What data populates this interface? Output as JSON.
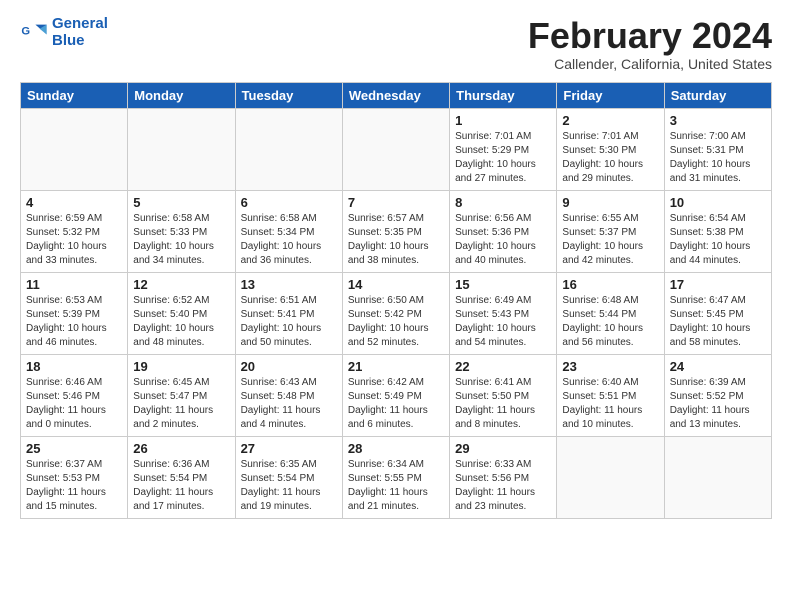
{
  "logo": {
    "line1": "General",
    "line2": "Blue"
  },
  "title": "February 2024",
  "subtitle": "Callender, California, United States",
  "days_of_week": [
    "Sunday",
    "Monday",
    "Tuesday",
    "Wednesday",
    "Thursday",
    "Friday",
    "Saturday"
  ],
  "weeks": [
    [
      {
        "day": "",
        "info": ""
      },
      {
        "day": "",
        "info": ""
      },
      {
        "day": "",
        "info": ""
      },
      {
        "day": "",
        "info": ""
      },
      {
        "day": "1",
        "info": "Sunrise: 7:01 AM\nSunset: 5:29 PM\nDaylight: 10 hours\nand 27 minutes."
      },
      {
        "day": "2",
        "info": "Sunrise: 7:01 AM\nSunset: 5:30 PM\nDaylight: 10 hours\nand 29 minutes."
      },
      {
        "day": "3",
        "info": "Sunrise: 7:00 AM\nSunset: 5:31 PM\nDaylight: 10 hours\nand 31 minutes."
      }
    ],
    [
      {
        "day": "4",
        "info": "Sunrise: 6:59 AM\nSunset: 5:32 PM\nDaylight: 10 hours\nand 33 minutes."
      },
      {
        "day": "5",
        "info": "Sunrise: 6:58 AM\nSunset: 5:33 PM\nDaylight: 10 hours\nand 34 minutes."
      },
      {
        "day": "6",
        "info": "Sunrise: 6:58 AM\nSunset: 5:34 PM\nDaylight: 10 hours\nand 36 minutes."
      },
      {
        "day": "7",
        "info": "Sunrise: 6:57 AM\nSunset: 5:35 PM\nDaylight: 10 hours\nand 38 minutes."
      },
      {
        "day": "8",
        "info": "Sunrise: 6:56 AM\nSunset: 5:36 PM\nDaylight: 10 hours\nand 40 minutes."
      },
      {
        "day": "9",
        "info": "Sunrise: 6:55 AM\nSunset: 5:37 PM\nDaylight: 10 hours\nand 42 minutes."
      },
      {
        "day": "10",
        "info": "Sunrise: 6:54 AM\nSunset: 5:38 PM\nDaylight: 10 hours\nand 44 minutes."
      }
    ],
    [
      {
        "day": "11",
        "info": "Sunrise: 6:53 AM\nSunset: 5:39 PM\nDaylight: 10 hours\nand 46 minutes."
      },
      {
        "day": "12",
        "info": "Sunrise: 6:52 AM\nSunset: 5:40 PM\nDaylight: 10 hours\nand 48 minutes."
      },
      {
        "day": "13",
        "info": "Sunrise: 6:51 AM\nSunset: 5:41 PM\nDaylight: 10 hours\nand 50 minutes."
      },
      {
        "day": "14",
        "info": "Sunrise: 6:50 AM\nSunset: 5:42 PM\nDaylight: 10 hours\nand 52 minutes."
      },
      {
        "day": "15",
        "info": "Sunrise: 6:49 AM\nSunset: 5:43 PM\nDaylight: 10 hours\nand 54 minutes."
      },
      {
        "day": "16",
        "info": "Sunrise: 6:48 AM\nSunset: 5:44 PM\nDaylight: 10 hours\nand 56 minutes."
      },
      {
        "day": "17",
        "info": "Sunrise: 6:47 AM\nSunset: 5:45 PM\nDaylight: 10 hours\nand 58 minutes."
      }
    ],
    [
      {
        "day": "18",
        "info": "Sunrise: 6:46 AM\nSunset: 5:46 PM\nDaylight: 11 hours\nand 0 minutes."
      },
      {
        "day": "19",
        "info": "Sunrise: 6:45 AM\nSunset: 5:47 PM\nDaylight: 11 hours\nand 2 minutes."
      },
      {
        "day": "20",
        "info": "Sunrise: 6:43 AM\nSunset: 5:48 PM\nDaylight: 11 hours\nand 4 minutes."
      },
      {
        "day": "21",
        "info": "Sunrise: 6:42 AM\nSunset: 5:49 PM\nDaylight: 11 hours\nand 6 minutes."
      },
      {
        "day": "22",
        "info": "Sunrise: 6:41 AM\nSunset: 5:50 PM\nDaylight: 11 hours\nand 8 minutes."
      },
      {
        "day": "23",
        "info": "Sunrise: 6:40 AM\nSunset: 5:51 PM\nDaylight: 11 hours\nand 10 minutes."
      },
      {
        "day": "24",
        "info": "Sunrise: 6:39 AM\nSunset: 5:52 PM\nDaylight: 11 hours\nand 13 minutes."
      }
    ],
    [
      {
        "day": "25",
        "info": "Sunrise: 6:37 AM\nSunset: 5:53 PM\nDaylight: 11 hours\nand 15 minutes."
      },
      {
        "day": "26",
        "info": "Sunrise: 6:36 AM\nSunset: 5:54 PM\nDaylight: 11 hours\nand 17 minutes."
      },
      {
        "day": "27",
        "info": "Sunrise: 6:35 AM\nSunset: 5:54 PM\nDaylight: 11 hours\nand 19 minutes."
      },
      {
        "day": "28",
        "info": "Sunrise: 6:34 AM\nSunset: 5:55 PM\nDaylight: 11 hours\nand 21 minutes."
      },
      {
        "day": "29",
        "info": "Sunrise: 6:33 AM\nSunset: 5:56 PM\nDaylight: 11 hours\nand 23 minutes."
      },
      {
        "day": "",
        "info": ""
      },
      {
        "day": "",
        "info": ""
      }
    ]
  ]
}
